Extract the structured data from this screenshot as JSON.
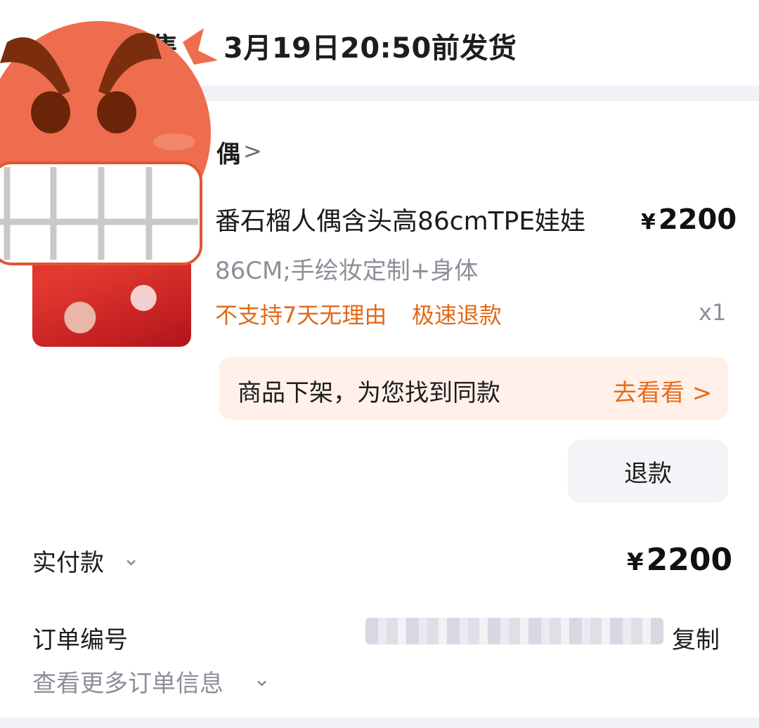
{
  "header": {
    "partial_label": "售",
    "ship_notice": "3月19日20:50前发货"
  },
  "shop": {
    "name_partial": "偶",
    "chevron": ">"
  },
  "product": {
    "image_icon": "product-photo",
    "title": "番石榴人偶含头高86cmTPE娃娃",
    "currency": "¥",
    "price": "2200",
    "spec": "86CM;手绘妆定制+身体",
    "tags": [
      "不支持7天无理由",
      "极速退款"
    ],
    "quantity": "x1"
  },
  "banner": {
    "text": "商品下架，为您找到同款",
    "link": "去看看 >"
  },
  "actions": {
    "refund": "退款"
  },
  "payment": {
    "label": "实付款",
    "currency": "¥",
    "amount": "2200"
  },
  "order": {
    "number_label": "订单编号",
    "copy": "复制",
    "more": "查看更多订单信息"
  },
  "colors": {
    "accent_orange": "#e06a1b",
    "banner_bg": "#fff1ea",
    "sticker": "#ee6d4f"
  },
  "overlay": {
    "sticker_icon": "angry-face-sticker"
  }
}
